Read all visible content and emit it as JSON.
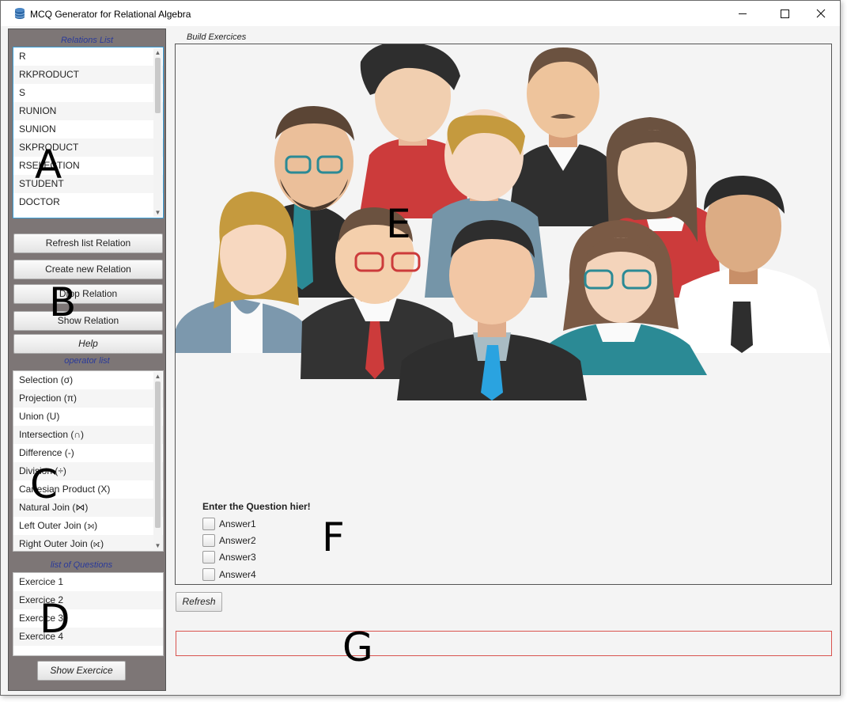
{
  "window": {
    "title": "MCQ Generator for Relational Algebra"
  },
  "sidebar": {
    "relations_label": "Relations List",
    "relations": [
      "R",
      "RKPRODUCT",
      "S",
      "RUNION",
      "SUNION",
      "SKPRODUCT",
      "RSELECTION",
      "STUDENT",
      "DOCTOR"
    ],
    "buttons": {
      "refresh": "Refresh list Relation",
      "create": "Create new Relation",
      "drop": "Drop Relation",
      "show": "Show Relation",
      "help": "Help"
    },
    "operators_label": "operator list",
    "operators": [
      "Selection (σ)",
      "Projection (π)",
      "Union (U)",
      "Intersection (∩)",
      "Difference (-)",
      "Division (÷)",
      "Cartesian Product (X)",
      "Natural Join (⋈)",
      "Left Outer Join (⟕)",
      "Right Outer Join (⟖)"
    ],
    "questions_label": "list of Questions",
    "questions": [
      "Exercice 1",
      "Exercice 2",
      "Exercice 3",
      "Exercice 4"
    ],
    "show_exercice": "Show Exercice"
  },
  "main": {
    "build_label": "Build Exercices",
    "question": "Enter the Question hier!",
    "answers": [
      "Answer1",
      "Answer2",
      "Answer3",
      "Answer4"
    ],
    "refresh_label": "Refresh"
  },
  "annotations": {
    "a": "A",
    "b": "B",
    "c": "C",
    "d": "D",
    "e": "E",
    "f": "F",
    "g": "G"
  }
}
